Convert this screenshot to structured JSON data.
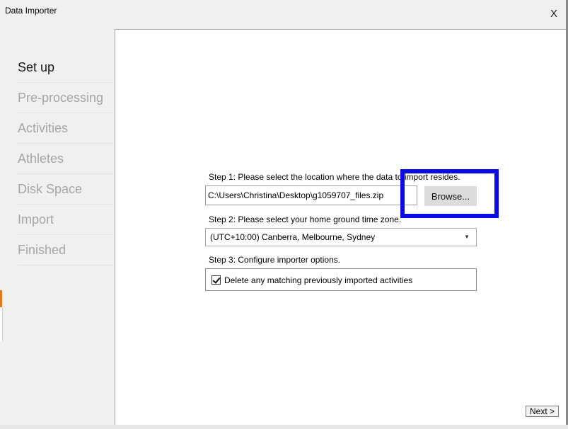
{
  "window": {
    "title": "Data Importer",
    "close_label": "X"
  },
  "sidebar": {
    "items": [
      {
        "label": "Set up",
        "active": true
      },
      {
        "label": "Pre-processing",
        "active": false
      },
      {
        "label": "Activities",
        "active": false
      },
      {
        "label": "Athletes",
        "active": false
      },
      {
        "label": "Disk Space",
        "active": false
      },
      {
        "label": "Import",
        "active": false
      },
      {
        "label": "Finished",
        "active": false
      }
    ]
  },
  "step1": {
    "label": "Step 1: Please select the location where the data to import resides.",
    "path_value": "C:\\Users\\Christina\\Desktop\\g1059707_files.zip",
    "browse_label": "Browse..."
  },
  "step2": {
    "label": "Step 2: Please select your home ground time zone.",
    "selected": "(UTC+10:00) Canberra, Melbourne, Sydney"
  },
  "step3": {
    "label": "Step 3: Configure importer options.",
    "checkbox_label": "Delete any matching previously imported activities",
    "checked": true
  },
  "footer": {
    "next_label": "Next >"
  },
  "colors": {
    "highlight": "#0a0ae6",
    "inactive_nav": "#a5a5a5",
    "active_nav": "#1a1a1a"
  },
  "icons": {
    "dropdown": "chevron-down-icon",
    "check": "check-icon"
  }
}
